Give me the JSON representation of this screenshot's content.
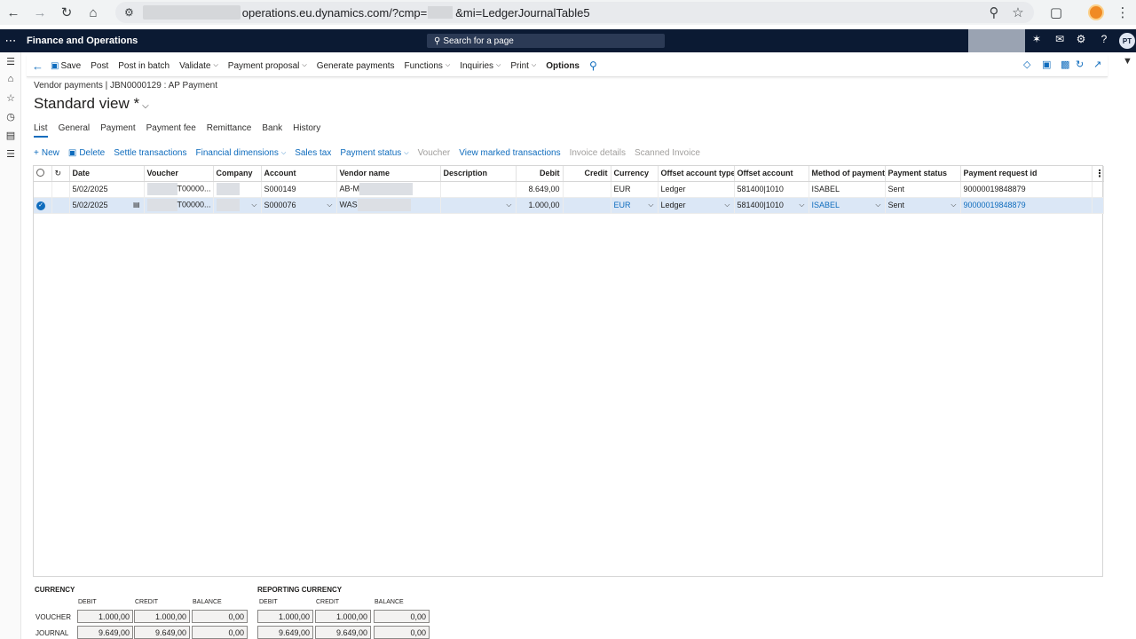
{
  "browser": {
    "url_visible": "operations.eu.dynamics.com/?cmp=",
    "url_tail": "&mi=LedgerJournalTable5"
  },
  "app": {
    "title": "Finance and Operations",
    "search_placeholder": "Search for a page",
    "user_initials": "PT"
  },
  "actions": {
    "save": "Save",
    "post": "Post",
    "post_in_batch": "Post in batch",
    "validate": "Validate",
    "payment_proposal": "Payment proposal",
    "generate_payments": "Generate payments",
    "functions": "Functions",
    "inquiries": "Inquiries",
    "print": "Print",
    "options": "Options"
  },
  "page": {
    "breadcrumb": "Vendor payments  |  JBN0000129 : AP Payment",
    "view_title": "Standard view *"
  },
  "tabs": [
    "List",
    "General",
    "Payment",
    "Payment fee",
    "Remittance",
    "Bank",
    "History"
  ],
  "grid_tools": {
    "new": "New",
    "delete": "Delete",
    "settle": "Settle transactions",
    "financial_dimensions": "Financial dimensions",
    "sales_tax": "Sales tax",
    "payment_status": "Payment status",
    "voucher": "Voucher",
    "view_marked": "View marked transactions",
    "invoice_details": "Invoice details",
    "scanned_invoice": "Scanned Invoice"
  },
  "grid": {
    "columns": [
      "Date",
      "Voucher",
      "Company",
      "Account",
      "Vendor name",
      "Description",
      "Debit",
      "Credit",
      "Currency",
      "Offset account type",
      "Offset account",
      "Method of payment",
      "Payment status",
      "Payment request id"
    ],
    "rows": [
      {
        "date": "5/02/2025",
        "voucher": "T00000...",
        "company": "",
        "account": "S000149",
        "vendor_name": "AB-M",
        "description": "",
        "debit": "8.649,00",
        "credit": "",
        "currency": "EUR",
        "offset_account_type": "Ledger",
        "offset_account": "581400|1010",
        "method_of_payment": "ISABEL",
        "payment_status": "Sent",
        "payment_request_id": "90000019848879"
      },
      {
        "date": "5/02/2025",
        "voucher": "T00000...",
        "company": "",
        "account": "S000076",
        "vendor_name": "WAS",
        "description": "",
        "debit": "1.000,00",
        "credit": "",
        "currency": "EUR",
        "offset_account_type": "Ledger",
        "offset_account": "581400|1010",
        "method_of_payment": "ISABEL",
        "payment_status": "Sent",
        "payment_request_id": "90000019848879"
      }
    ]
  },
  "totals": {
    "currency_label": "CURRENCY",
    "reporting_label": "REPORTING CURRENCY",
    "debit_label": "DEBIT",
    "credit_label": "CREDIT",
    "balance_label": "BALANCE",
    "voucher_label": "VOUCHER",
    "journal_label": "JOURNAL",
    "voucher": {
      "debit": "1.000,00",
      "credit": "1.000,00",
      "balance": "0,00",
      "rep_debit": "1.000,00",
      "rep_credit": "1.000,00",
      "rep_balance": "0,00"
    },
    "journal": {
      "debit": "9.649,00",
      "credit": "9.649,00",
      "balance": "0,00",
      "rep_debit": "9.649,00",
      "rep_credit": "9.649,00",
      "rep_balance": "0,00"
    }
  }
}
